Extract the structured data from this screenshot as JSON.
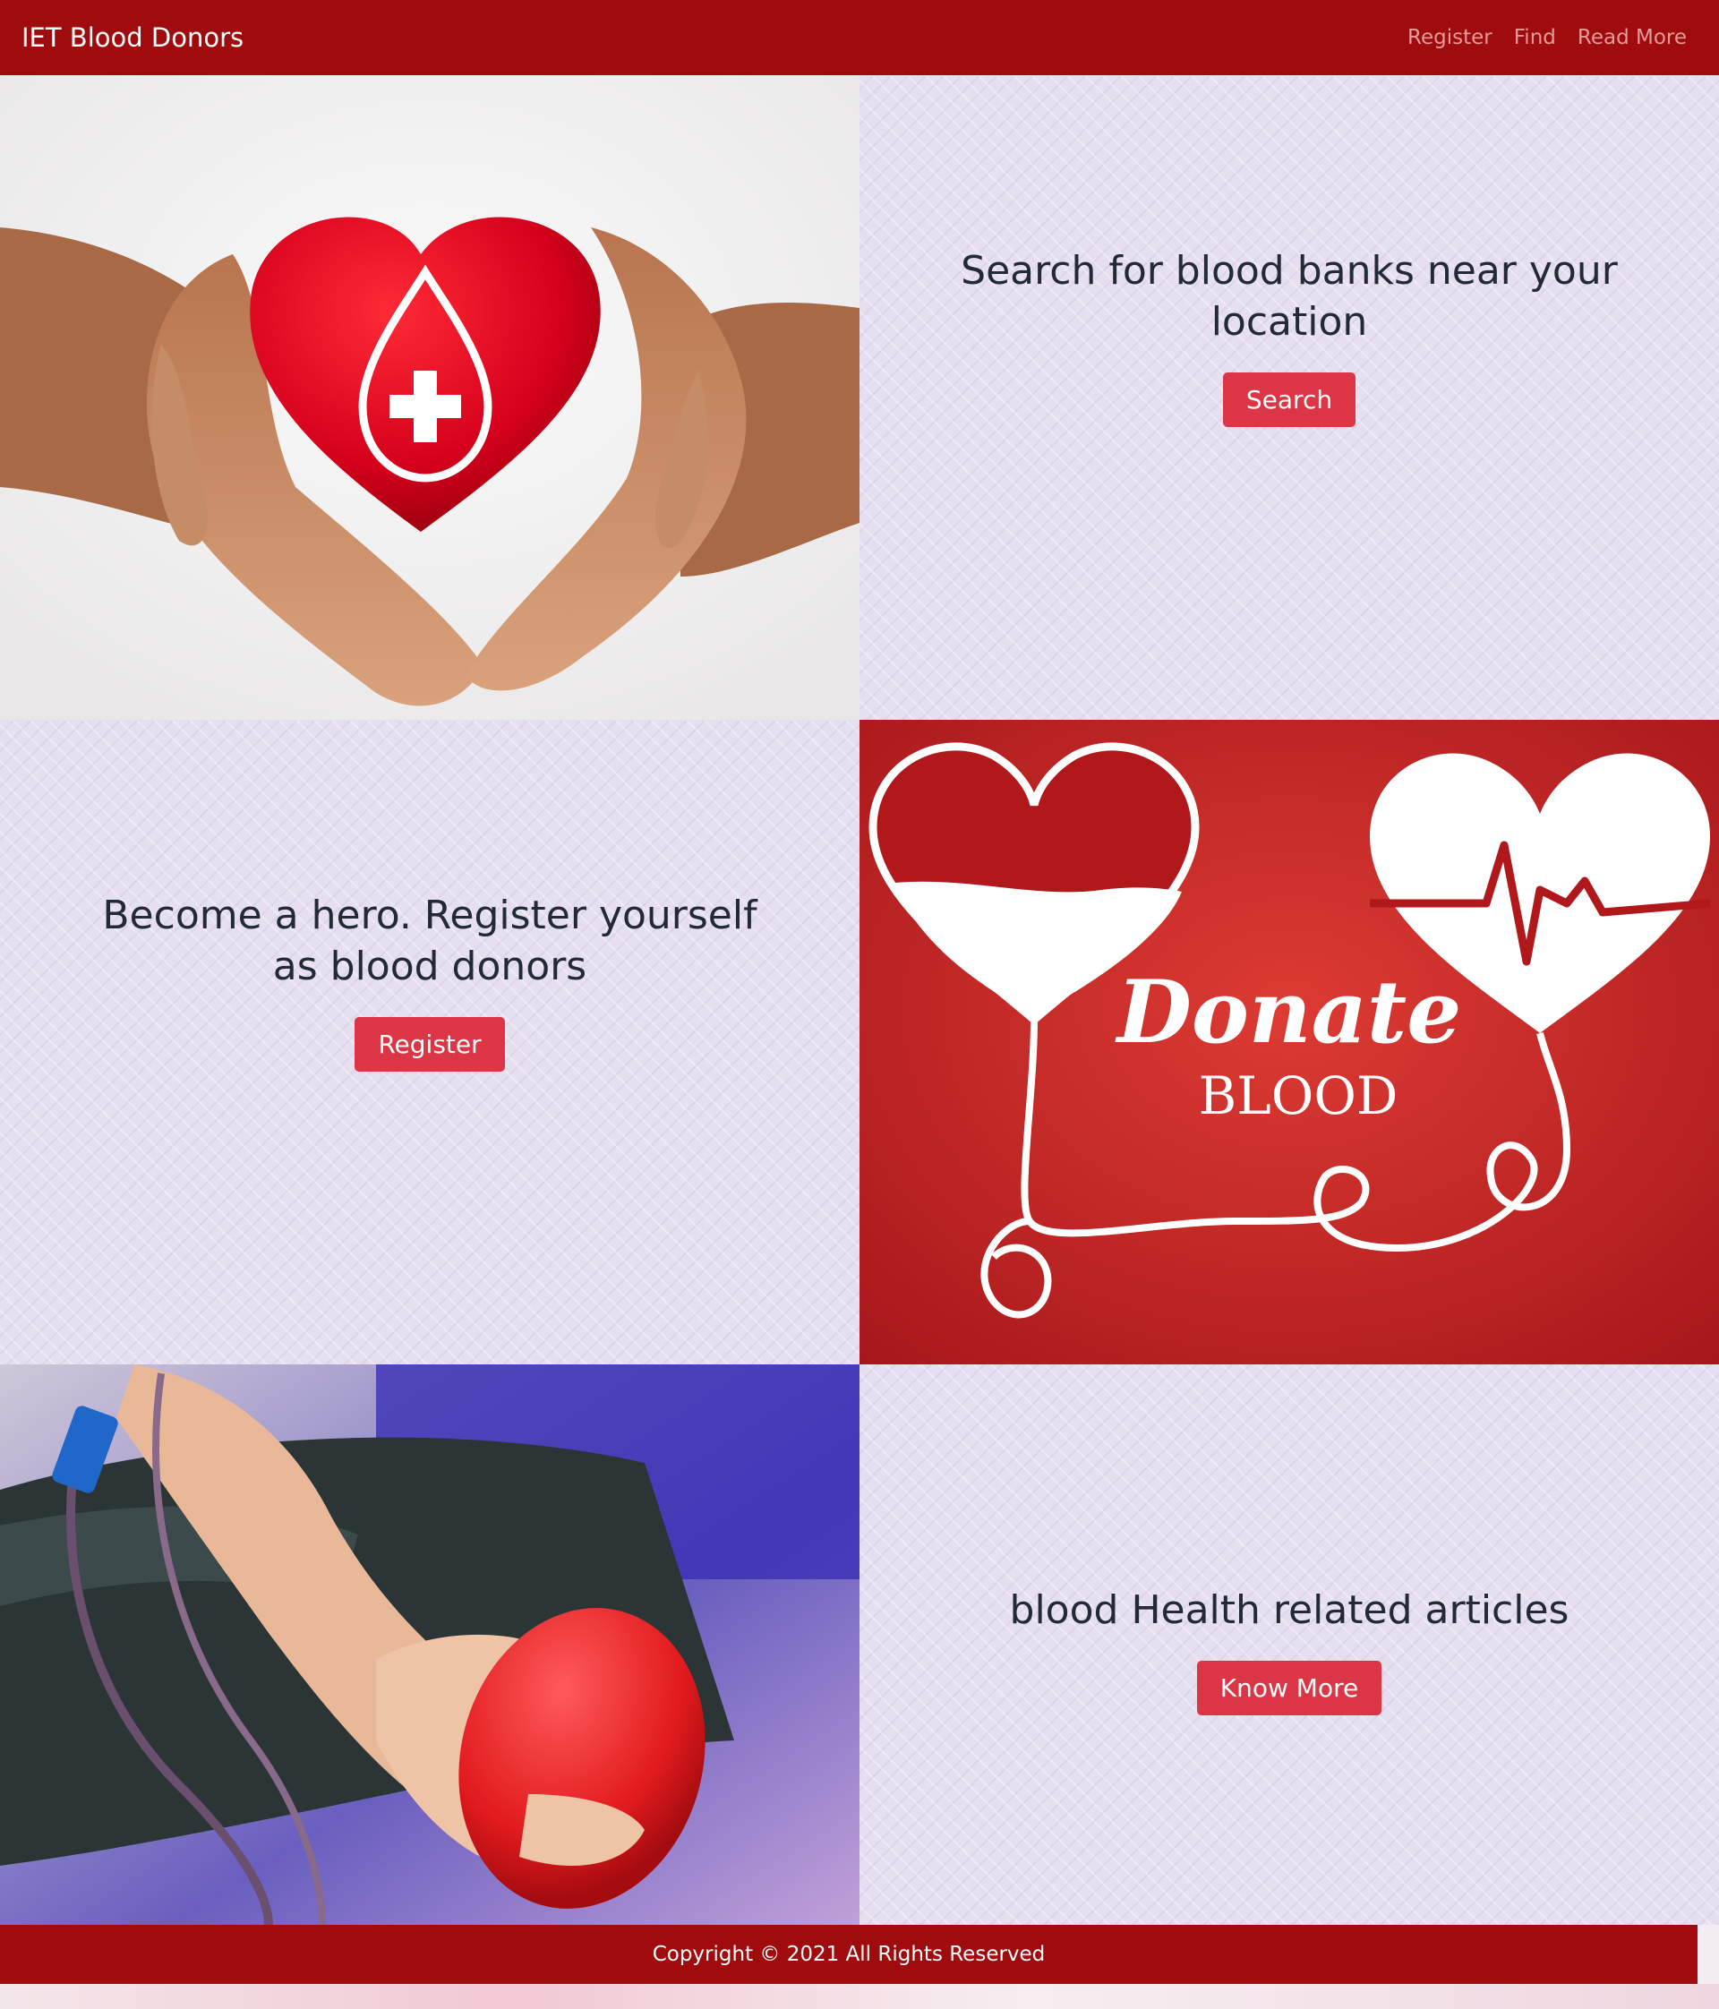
{
  "navbar": {
    "brand": "IET Blood Donors",
    "links": [
      "Register",
      "Find",
      "Read More"
    ]
  },
  "sections": [
    {
      "heading": "Search for blood banks near your location",
      "button": "Search"
    },
    {
      "heading": "Become a hero. Register yourself as blood donors",
      "button": "Register"
    },
    {
      "heading": "blood Health related articles",
      "button": "Know More"
    }
  ],
  "images": {
    "donate_graphic_text": "Donate",
    "donate_graphic_subtext": "BLOOD"
  },
  "footer": {
    "text": "Copyright © 2021 All Rights Reserved"
  },
  "colors": {
    "brand_red": "#a00b0d",
    "button_red": "#dc3545",
    "panel_bg": "#e6dff0"
  }
}
